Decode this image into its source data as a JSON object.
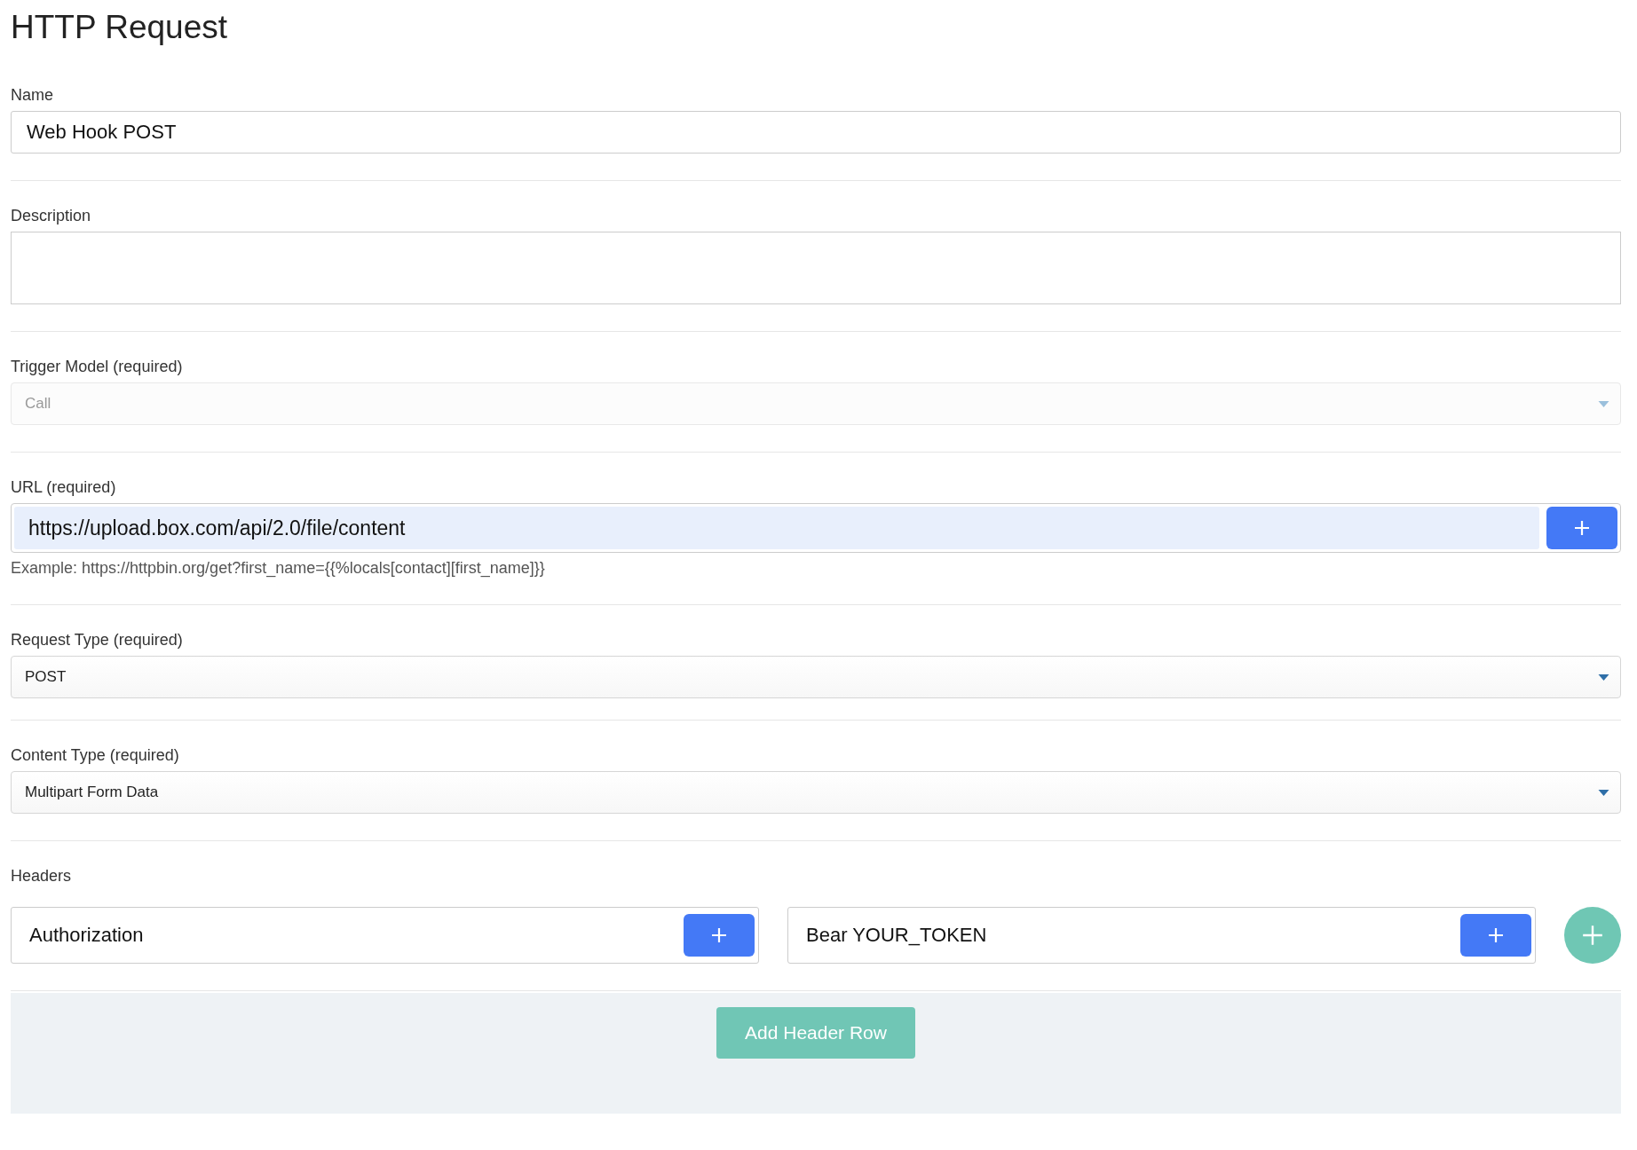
{
  "title": "HTTP Request",
  "fields": [
    {
      "kind": "text",
      "label": "Name",
      "value": "Web Hook POST"
    },
    {
      "kind": "textarea",
      "label": "Description"
    },
    {
      "kind": "select",
      "label": "Trigger Model (required)",
      "value": "Call",
      "disabled": true
    },
    {
      "kind": "url",
      "label": "URL (required)",
      "value": "https://upload.box.com/api/2.0/file/content",
      "hint": "Example: https://httpbin.org/get?first_name={{%locals[contact][first_name]}}"
    },
    {
      "kind": "select",
      "label": "Request Type (required)",
      "value": "POST",
      "disabled": false
    },
    {
      "kind": "select",
      "label": "Content Type (required)",
      "value": "Multipart Form Data",
      "disabled": false
    },
    {
      "kind": "headers",
      "label": "Headers",
      "rows": [
        {
          "key": "Authorization",
          "value": "Bear YOUR_TOKEN"
        }
      ]
    }
  ],
  "add_button": "Add Header Row"
}
